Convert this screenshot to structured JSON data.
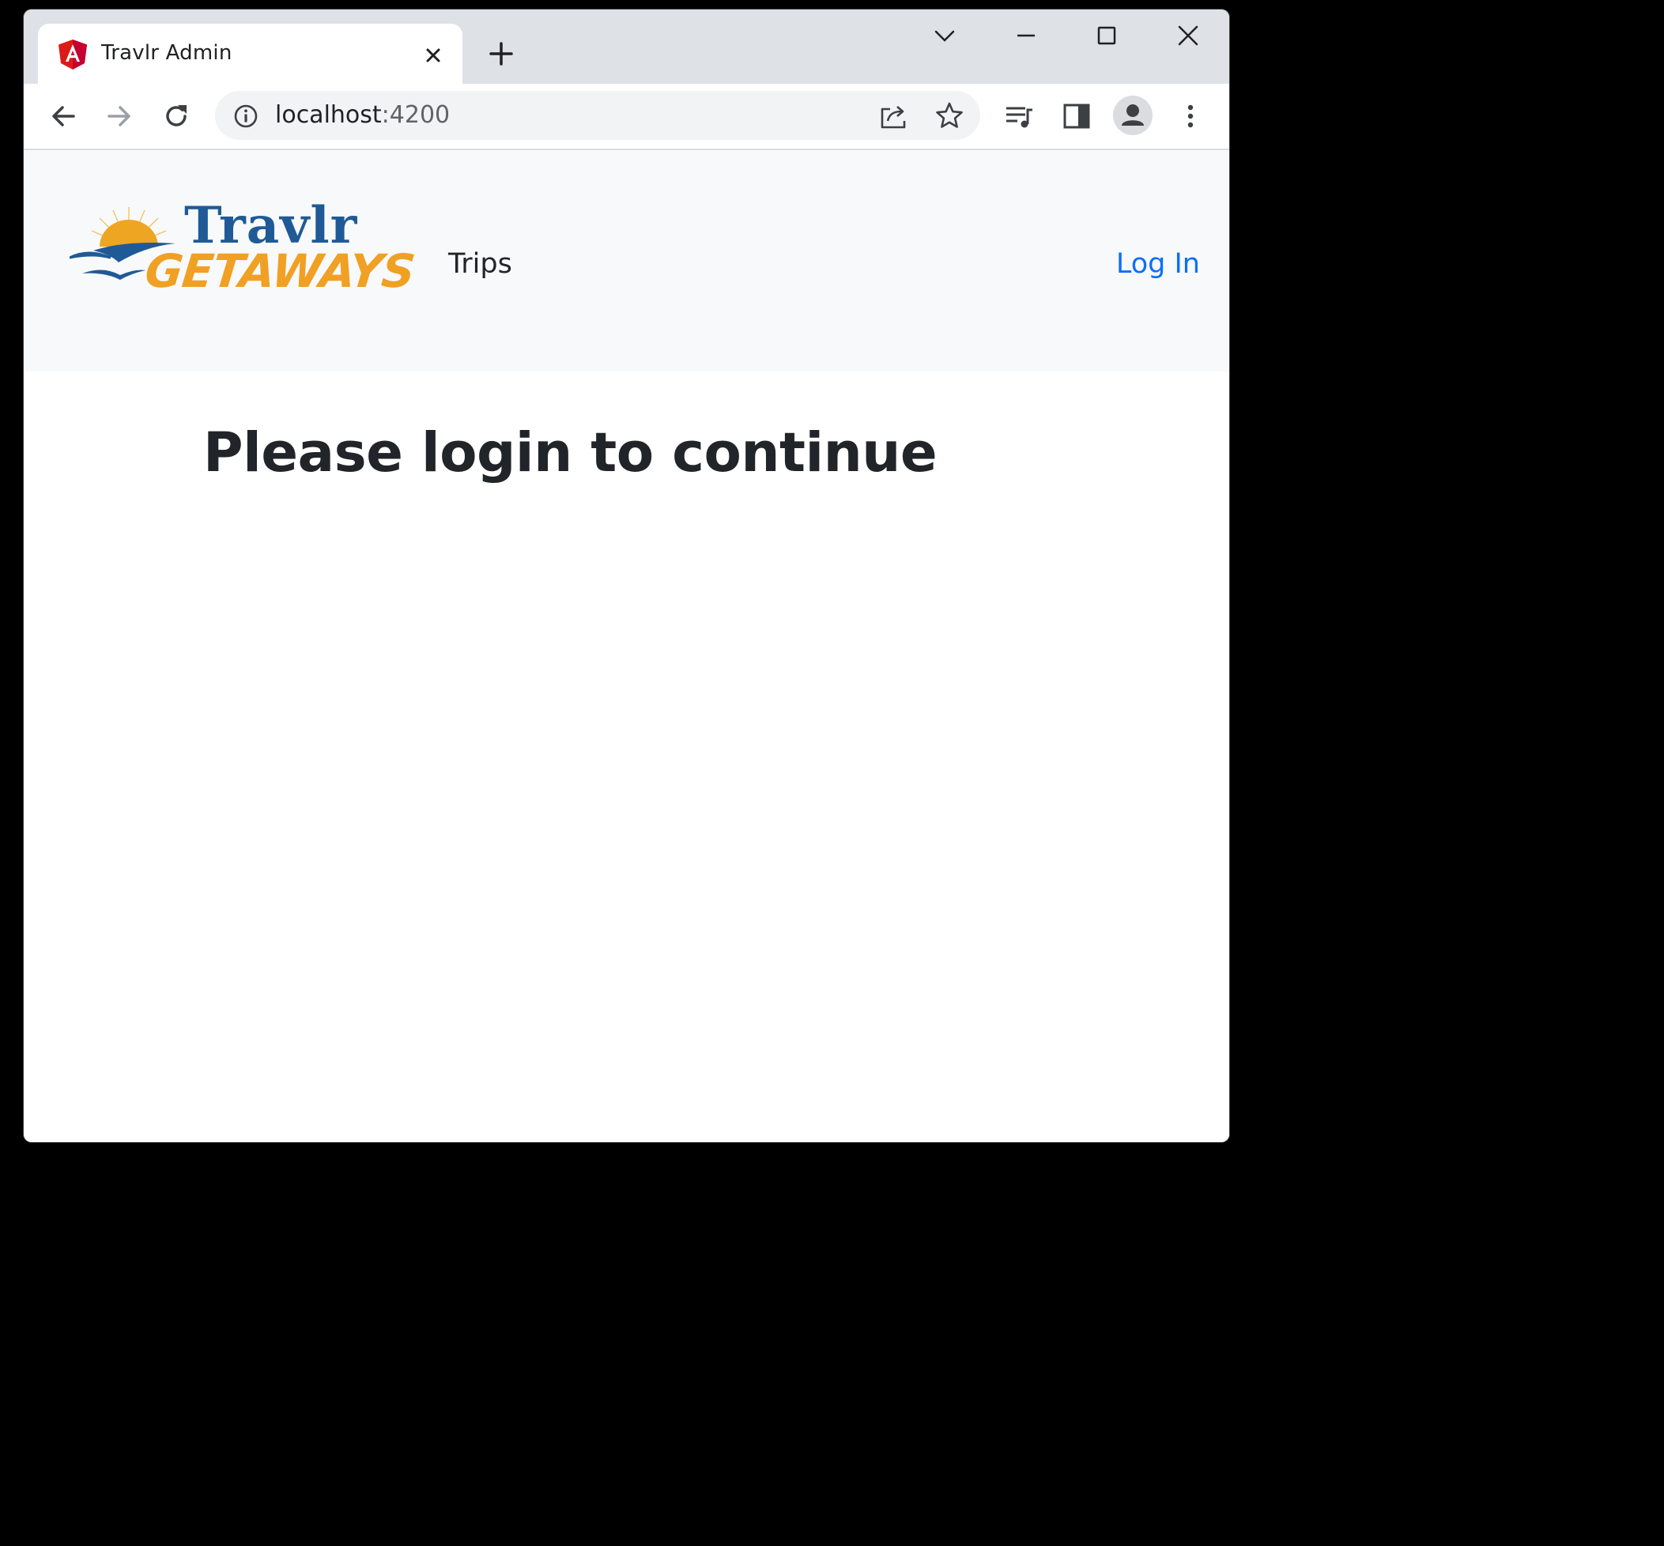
{
  "browser": {
    "tab": {
      "title": "Travlr Admin",
      "favicon": "angular-icon"
    },
    "address": {
      "host": "localhost",
      "port": ":4200"
    },
    "icons": {
      "back": "arrow-left-icon",
      "forward": "arrow-right-icon",
      "reload": "reload-icon",
      "site_info": "info-icon",
      "share": "share-icon",
      "bookmark": "star-icon",
      "media": "media-control-icon",
      "side_panel": "side-panel-icon",
      "profile": "profile-avatar-icon",
      "menu": "kebab-menu-icon"
    },
    "colors": {
      "tabstrip": "#dee1e6",
      "omnibox": "#f1f3f4"
    }
  },
  "site": {
    "logo": {
      "line1": "Travlr",
      "line2": "GETAWAYS"
    },
    "nav": {
      "trips": "Trips",
      "login": "Log In"
    },
    "colors": {
      "navbar_bg": "#f8f9fa",
      "link": "#0d6efd",
      "text": "#212529",
      "logo_blue": "#1f5a96",
      "logo_orange": "#f0a023"
    }
  },
  "main": {
    "heading": "Please login to continue"
  }
}
